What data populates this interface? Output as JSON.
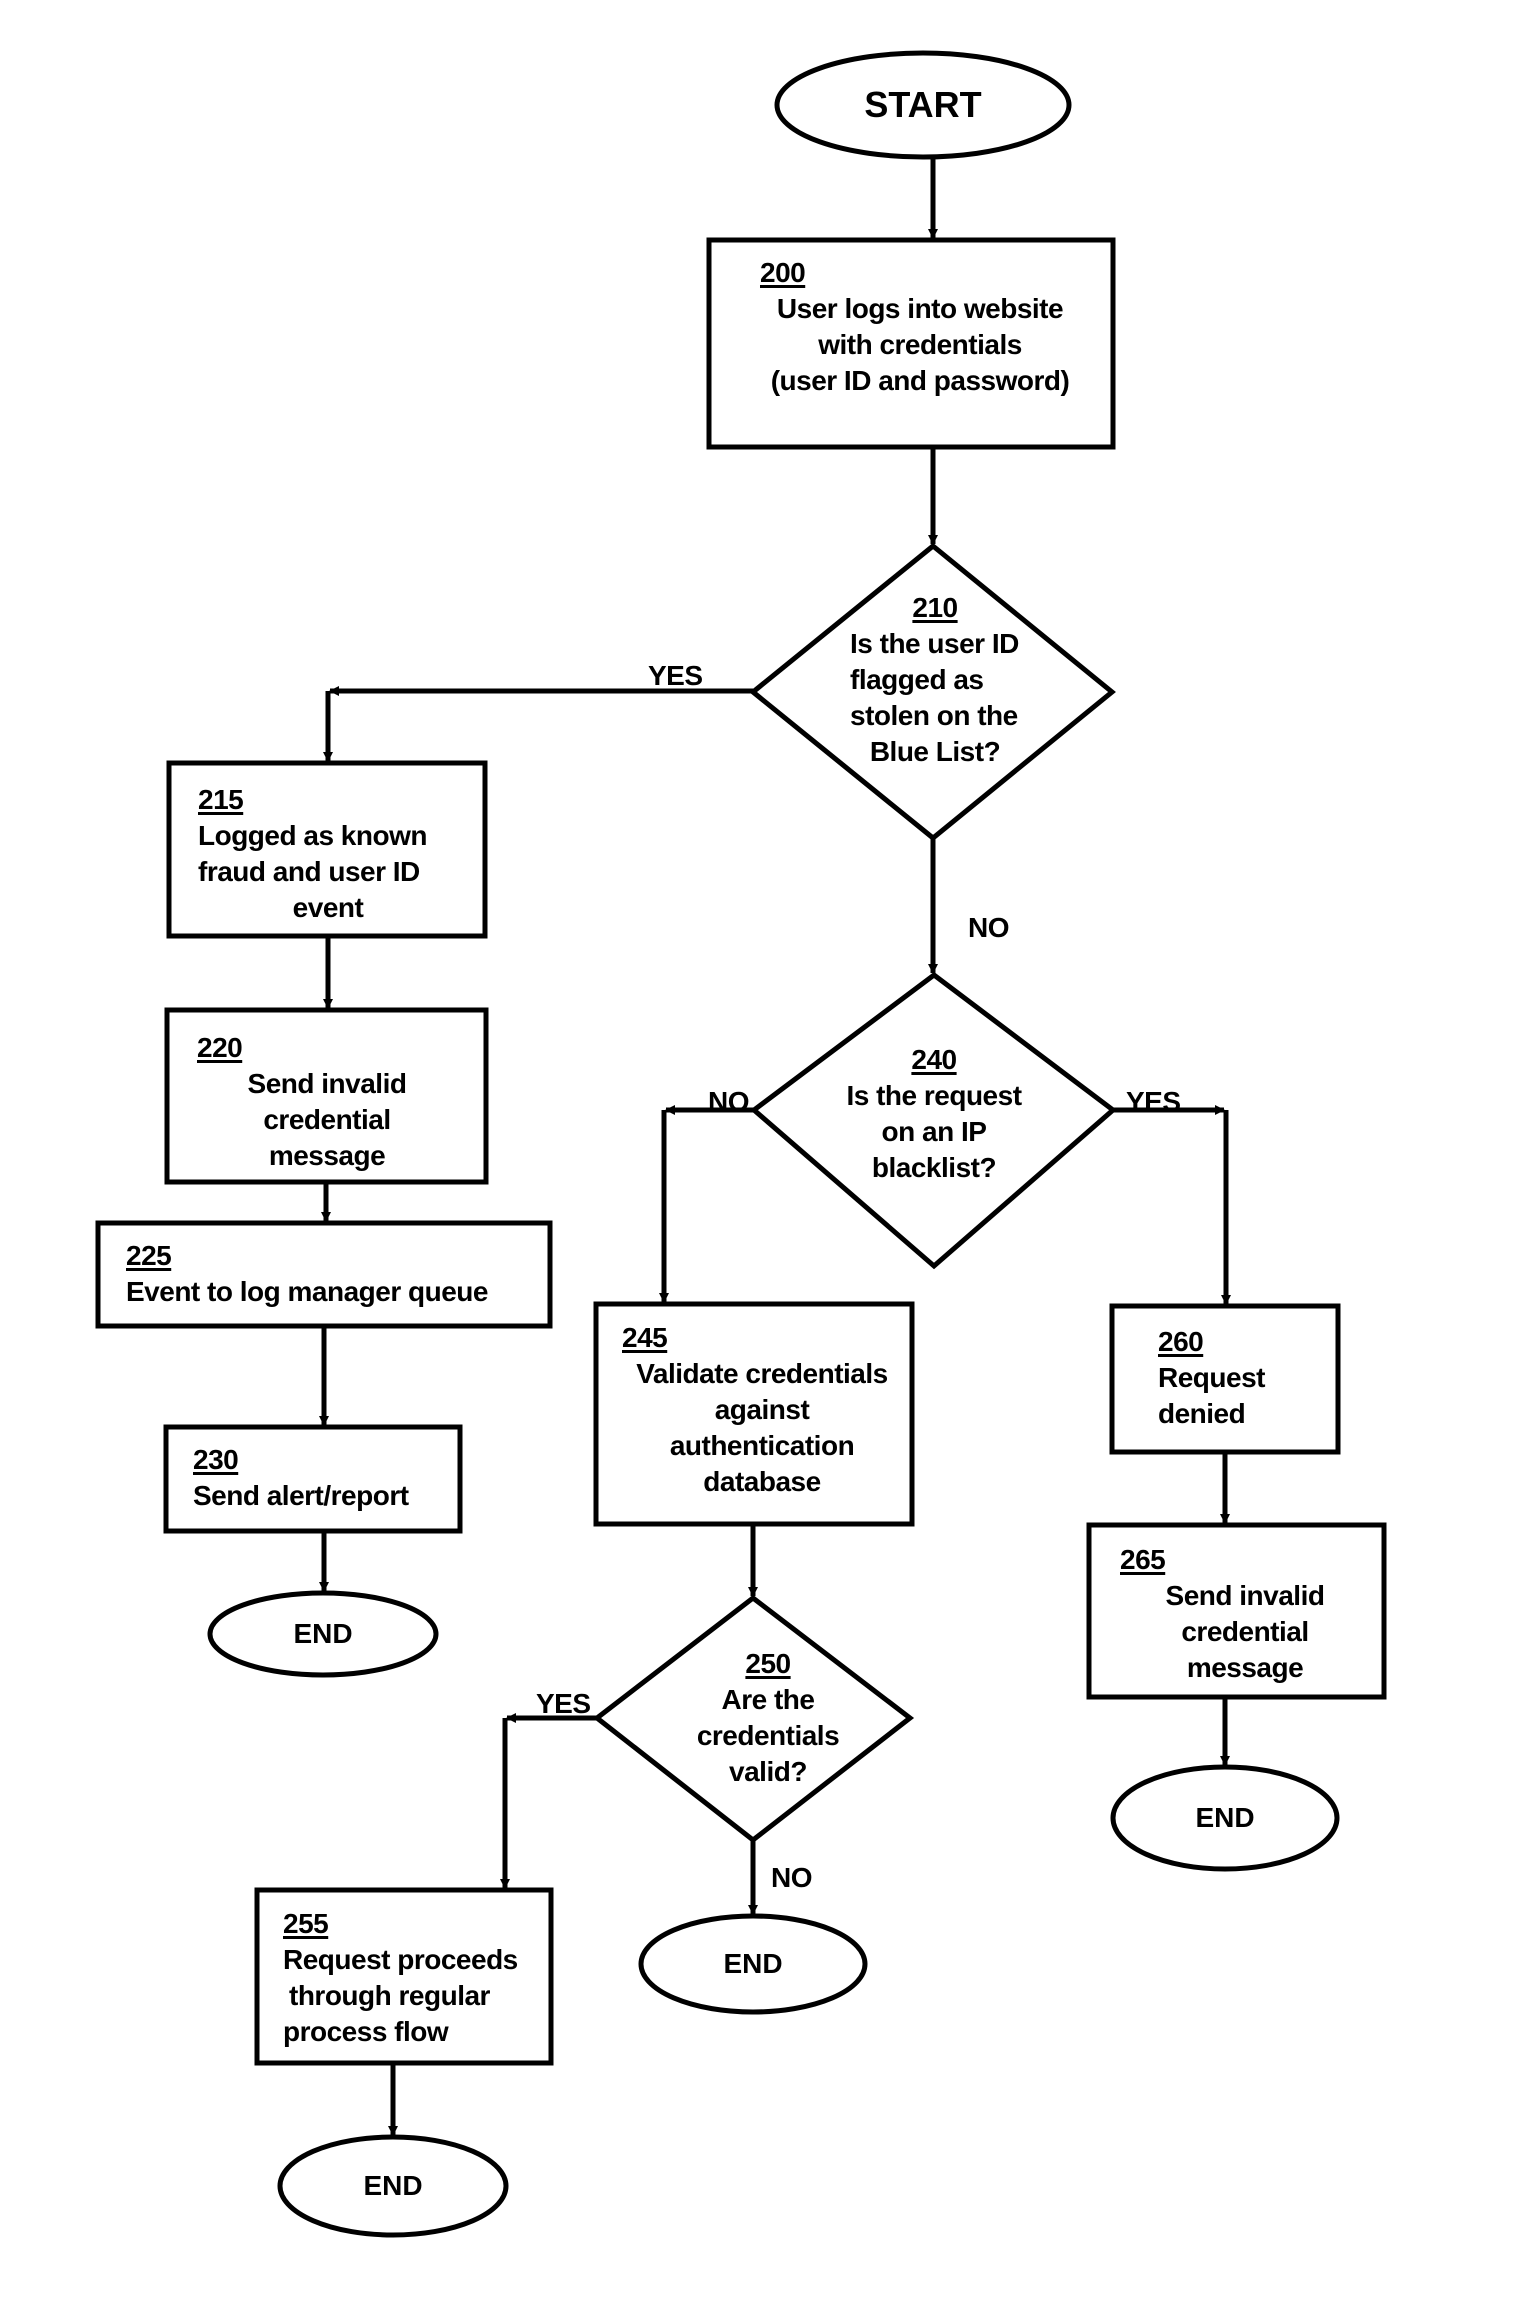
{
  "diagram": {
    "type": "flowchart",
    "start": {
      "label": "START"
    },
    "end_label": "END",
    "nodes": {
      "n200": {
        "ref": "200",
        "lines": [
          "User logs into website",
          "with credentials",
          "(user ID and password)"
        ]
      },
      "n210": {
        "ref": "210",
        "lines": [
          "Is the user ID",
          "flagged as",
          "stolen on the",
          "Blue List?"
        ]
      },
      "n215": {
        "ref": "215",
        "lines": [
          "Logged as known",
          "fraud and user ID",
          "event"
        ]
      },
      "n220": {
        "ref": "220",
        "lines": [
          "Send invalid",
          "credential",
          "message"
        ]
      },
      "n225": {
        "ref": "225",
        "lines": [
          "Event to log manager queue"
        ]
      },
      "n230": {
        "ref": "230",
        "lines": [
          "Send alert/report"
        ]
      },
      "n240": {
        "ref": "240",
        "lines": [
          "Is the request",
          "on an IP",
          "blacklist?"
        ]
      },
      "n245": {
        "ref": "245",
        "lines": [
          "Validate credentials",
          "against",
          "authentication",
          "database"
        ]
      },
      "n250": {
        "ref": "250",
        "lines": [
          "Are the",
          "credentials",
          "valid?"
        ]
      },
      "n255": {
        "ref": "255",
        "lines": [
          "Request proceeds",
          "through regular",
          "process flow"
        ]
      },
      "n260": {
        "ref": "260",
        "lines": [
          "Request",
          "denied"
        ]
      },
      "n265": {
        "ref": "265",
        "lines": [
          "Send invalid",
          "credential",
          "message"
        ]
      }
    },
    "edge_labels": {
      "e210_yes": "YES",
      "e210_no": "NO",
      "e240_no": "NO",
      "e240_yes": "YES",
      "e250_yes": "YES",
      "e250_no": "NO"
    },
    "edges": [
      [
        "START",
        "200"
      ],
      [
        "200",
        "210"
      ],
      [
        "210",
        "215",
        "YES"
      ],
      [
        "210",
        "240",
        "NO"
      ],
      [
        "215",
        "220"
      ],
      [
        "220",
        "225"
      ],
      [
        "225",
        "230"
      ],
      [
        "230",
        "END"
      ],
      [
        "240",
        "245",
        "NO"
      ],
      [
        "240",
        "260",
        "YES"
      ],
      [
        "245",
        "250"
      ],
      [
        "250",
        "255",
        "YES"
      ],
      [
        "250",
        "END",
        "NO"
      ],
      [
        "255",
        "END"
      ],
      [
        "260",
        "265"
      ],
      [
        "265",
        "END"
      ]
    ]
  }
}
